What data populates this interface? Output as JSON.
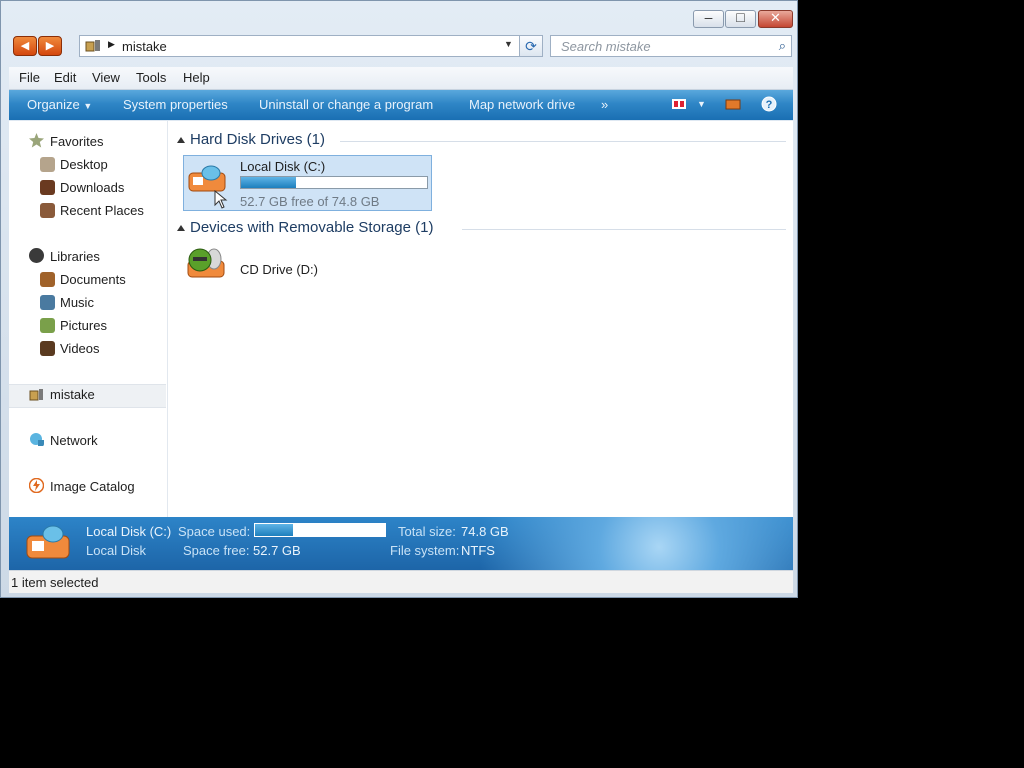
{
  "window": {
    "controls": {
      "minimize": "–",
      "maximize": "□",
      "close": "✕"
    }
  },
  "nav": {
    "back_icon": "arrow-left",
    "forward_icon": "arrow-right"
  },
  "address": {
    "path": "mistake"
  },
  "search": {
    "placeholder": "Search mistake"
  },
  "menu": [
    "File",
    "Edit",
    "View",
    "Tools",
    "Help"
  ],
  "commands": [
    "Organize",
    "System properties",
    "Uninstall or change a program",
    "Map network drive",
    "»"
  ],
  "sidebar": {
    "favorites": {
      "label": "Favorites",
      "items": [
        "Desktop",
        "Downloads",
        "Recent Places"
      ]
    },
    "libraries": {
      "label": "Libraries",
      "items": [
        "Documents",
        "Music",
        "Pictures",
        "Videos"
      ]
    },
    "computer": "mistake",
    "network": "Network",
    "catalog": "Image Catalog"
  },
  "groups": {
    "hdd": {
      "title": "Hard Disk Drives (1)",
      "drive": {
        "name": "Local Disk (C:)",
        "usage_fraction": 0.295,
        "free_text": "52.7 GB free of 74.8 GB"
      }
    },
    "removable": {
      "title": "Devices with Removable Storage (1)",
      "drive": {
        "name": "CD Drive (D:)"
      }
    }
  },
  "details": {
    "name": "Local Disk (C:)",
    "type": "Local Disk",
    "space_used_label": "Space used:",
    "space_free_label": "Space free:",
    "space_free_value": "52.7 GB",
    "total_label": "Total size:",
    "total_value": "74.8 GB",
    "fs_label": "File system:",
    "fs_value": "NTFS"
  },
  "status": {
    "text": "1 item selected"
  },
  "colors": {
    "accent": "#2f86c6",
    "selection": "#cfe3f6",
    "group_title": "#1e3d63"
  }
}
